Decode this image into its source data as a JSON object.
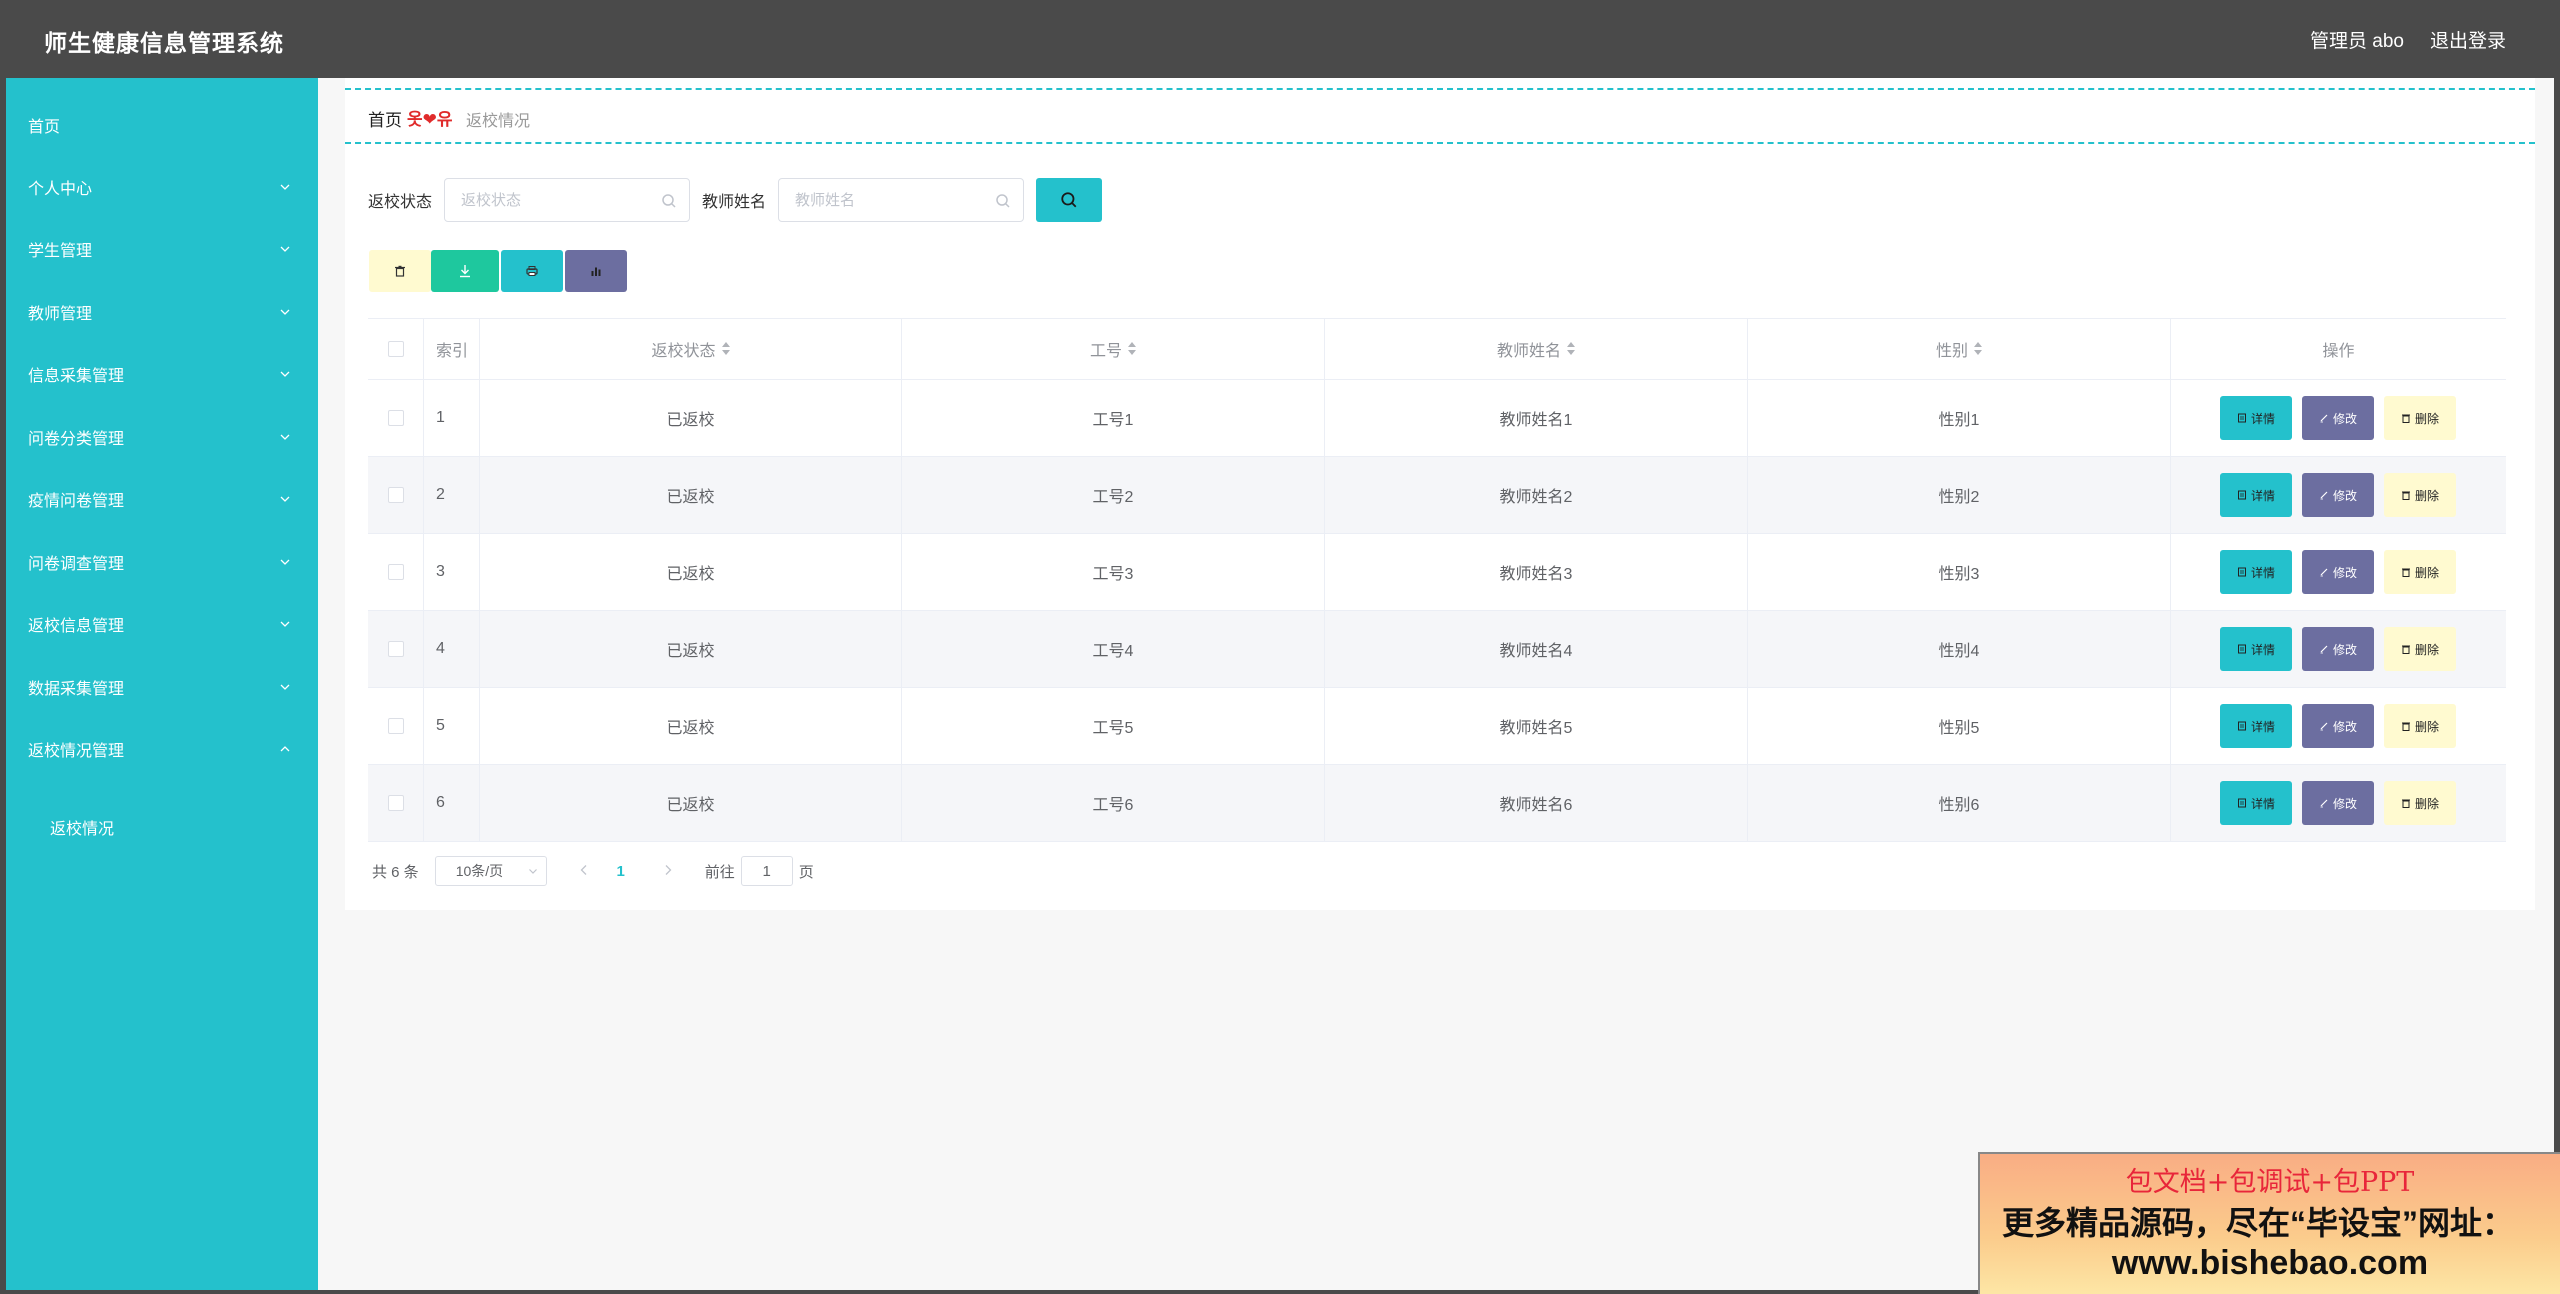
{
  "header": {
    "title": "师生健康信息管理系统",
    "user": "管理员 abo",
    "logout": "退出登录"
  },
  "sidebar": {
    "items": [
      {
        "label": "首页",
        "expandable": false
      },
      {
        "label": "个人中心",
        "expandable": true
      },
      {
        "label": "学生管理",
        "expandable": true
      },
      {
        "label": "教师管理",
        "expandable": true
      },
      {
        "label": "信息采集管理",
        "expandable": true
      },
      {
        "label": "问卷分类管理",
        "expandable": true
      },
      {
        "label": "疫情问卷管理",
        "expandable": true
      },
      {
        "label": "问卷调查管理",
        "expandable": true
      },
      {
        "label": "返校信息管理",
        "expandable": true
      },
      {
        "label": "数据采集管理",
        "expandable": true
      },
      {
        "label": "返校情况管理",
        "expandable": true,
        "expanded": true
      }
    ],
    "subitem": {
      "label": "返校情况"
    }
  },
  "breadcrumb": {
    "home": "首页",
    "separator": "옷❤유",
    "current": "返校情况"
  },
  "search": {
    "status_label": "返校状态",
    "status_placeholder": "返校状态",
    "name_label": "教师姓名",
    "name_placeholder": "教师姓名"
  },
  "toolbar": {
    "buttons": [
      {
        "icon": "trash-icon",
        "color": "#fffad0"
      },
      {
        "icon": "download-icon",
        "color": "#1ec89e"
      },
      {
        "icon": "print-icon",
        "color": "#24c1cc"
      },
      {
        "icon": "bar-chart-icon",
        "color": "#6c6ea0"
      }
    ]
  },
  "table": {
    "headers": {
      "index": "索引",
      "status": "返校状态",
      "no": "工号",
      "name": "教师姓名",
      "sex": "性别",
      "ops": "操作"
    },
    "rows": [
      {
        "index": "1",
        "status": "已返校",
        "no": "工号1",
        "name": "教师姓名1",
        "sex": "性别1"
      },
      {
        "index": "2",
        "status": "已返校",
        "no": "工号2",
        "name": "教师姓名2",
        "sex": "性别2"
      },
      {
        "index": "3",
        "status": "已返校",
        "no": "工号3",
        "name": "教师姓名3",
        "sex": "性别3"
      },
      {
        "index": "4",
        "status": "已返校",
        "no": "工号4",
        "name": "教师姓名4",
        "sex": "性别4"
      },
      {
        "index": "5",
        "status": "已返校",
        "no": "工号5",
        "name": "教师姓名5",
        "sex": "性别5"
      },
      {
        "index": "6",
        "status": "已返校",
        "no": "工号6",
        "name": "教师姓名6",
        "sex": "性别6"
      }
    ],
    "actions": {
      "detail": "详情",
      "edit": "修改",
      "delete": "删除"
    }
  },
  "pagination": {
    "total": "共 6 条",
    "page_size": "10条/页",
    "current_page": "1",
    "goto_prefix": "前往",
    "goto_value": "1",
    "goto_suffix": "页"
  },
  "promo": {
    "line1": "包文档+包调试+包PPT",
    "line2": "更多精品源码，尽在“毕设宝”网址：",
    "line3": "www.bishebao.com"
  },
  "colors": {
    "accent": "#24c1cc",
    "header_bg": "#4a4a4a",
    "edit": "#6c6ea0",
    "delete": "#fffad0",
    "download": "#1ec89e"
  }
}
